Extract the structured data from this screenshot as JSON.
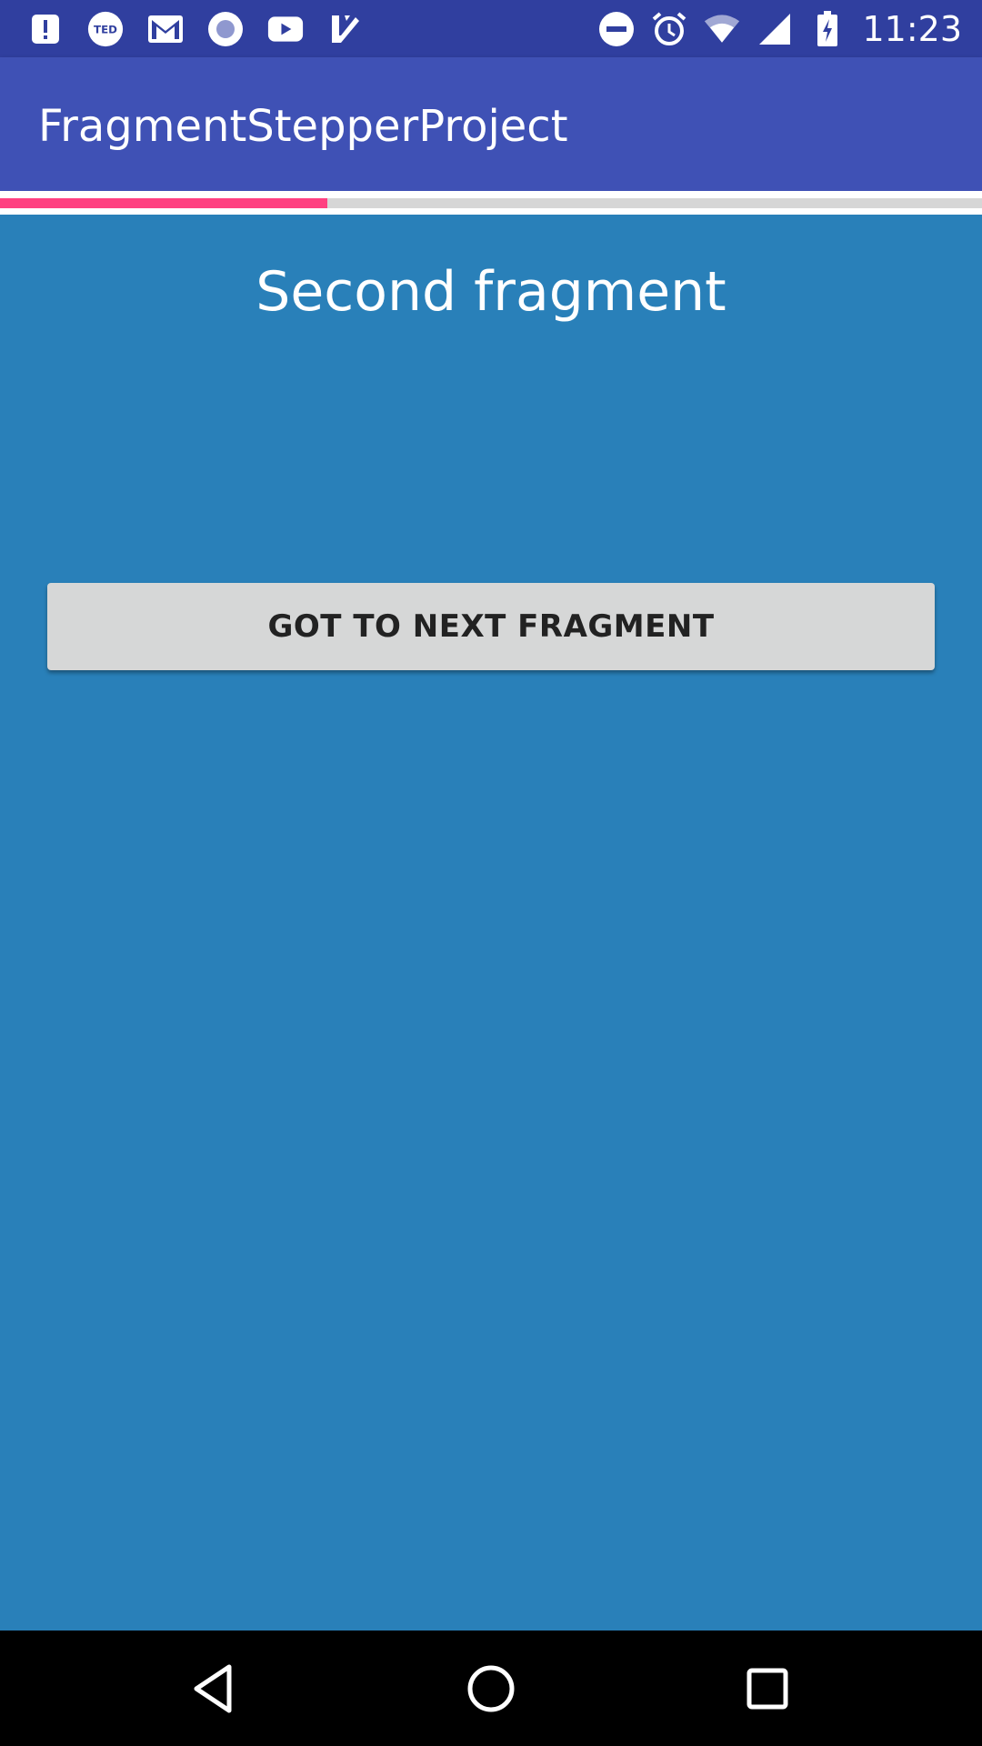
{
  "status_bar": {
    "time": "11:23",
    "left_icons": [
      "alert-icon",
      "ted-icon",
      "gmail-icon",
      "circle-app-icon",
      "youtube-icon",
      "tasks-check-icon"
    ],
    "right_icons": [
      "do-not-disturb-icon",
      "alarm-icon",
      "wifi-icon",
      "signal-icon",
      "battery-charging-icon"
    ],
    "ted_label": "TED"
  },
  "app_bar": {
    "title": "FragmentStepperProject",
    "color": "#3f51b5"
  },
  "stepper": {
    "progress_fraction": 0.333,
    "fill_color": "#ff4081",
    "track_color": "#d6d6d6"
  },
  "fragment": {
    "title": "Second fragment",
    "background": "#2980b9",
    "button_label": "GOT TO NEXT FRAGMENT"
  },
  "nav_bar": {
    "buttons": [
      "back-icon",
      "home-icon",
      "recents-icon"
    ]
  }
}
